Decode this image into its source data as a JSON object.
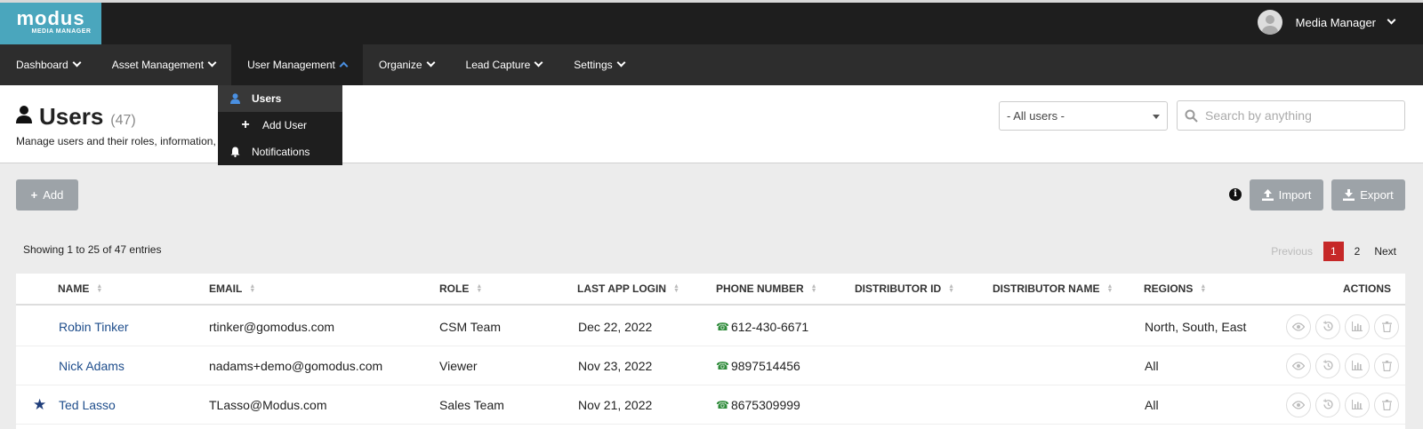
{
  "app": {
    "logo_main": "modus",
    "logo_sub": "MEDIA MANAGER",
    "user_name": "Media Manager"
  },
  "nav": {
    "items": [
      {
        "label": "Dashboard"
      },
      {
        "label": "Asset Management"
      },
      {
        "label": "User Management"
      },
      {
        "label": "Organize"
      },
      {
        "label": "Lead Capture"
      },
      {
        "label": "Settings"
      }
    ],
    "dropdown": [
      {
        "label": "Users"
      },
      {
        "label": "Add User"
      },
      {
        "label": "Notifications"
      }
    ]
  },
  "page": {
    "title": "Users",
    "count": "(47)",
    "subtitle": "Manage users and their roles, information,",
    "filter_value": "- All users -",
    "search_placeholder": "Search by anything"
  },
  "toolbar": {
    "add_label": "Add",
    "import_label": "Import",
    "export_label": "Export",
    "info_glyph": "i"
  },
  "listing": {
    "entries_text": "Showing 1 to 25 of 47 entries",
    "prev_label": "Previous",
    "pages": [
      "1",
      "2"
    ],
    "next_label": "Next"
  },
  "table": {
    "headers": [
      "NAME",
      "EMAIL",
      "ROLE",
      "LAST APP LOGIN",
      "PHONE NUMBER",
      "DISTRIBUTOR ID",
      "DISTRIBUTOR NAME",
      "REGIONS",
      "ACTIONS"
    ],
    "rows": [
      {
        "name": "Robin Tinker",
        "email": "rtinker@gomodus.com",
        "role": "CSM Team",
        "last_login": "Dec 22, 2022",
        "phone": "612-430-6671",
        "distributor_id": "",
        "distributor_name": "",
        "regions": "North, South, East"
      },
      {
        "name": "Nick Adams",
        "email": "nadams+demo@gomodus.com",
        "role": "Viewer",
        "last_login": "Nov 23, 2022",
        "phone": "9897514456",
        "distributor_id": "",
        "distributor_name": "",
        "regions": "All"
      },
      {
        "name": "Ted Lasso",
        "email": "TLasso@Modus.com",
        "role": "Sales Team",
        "last_login": "Nov 21, 2022",
        "phone": "8675309999",
        "distributor_id": "",
        "distributor_name": "",
        "regions": "All"
      }
    ]
  },
  "colors": {
    "brand": "#4aa6bd",
    "topbar": "#1e1e1e",
    "navbar": "#2d2d2d",
    "active_page": "#c62828",
    "link": "#1f4e8c",
    "button": "#9da3a8"
  }
}
